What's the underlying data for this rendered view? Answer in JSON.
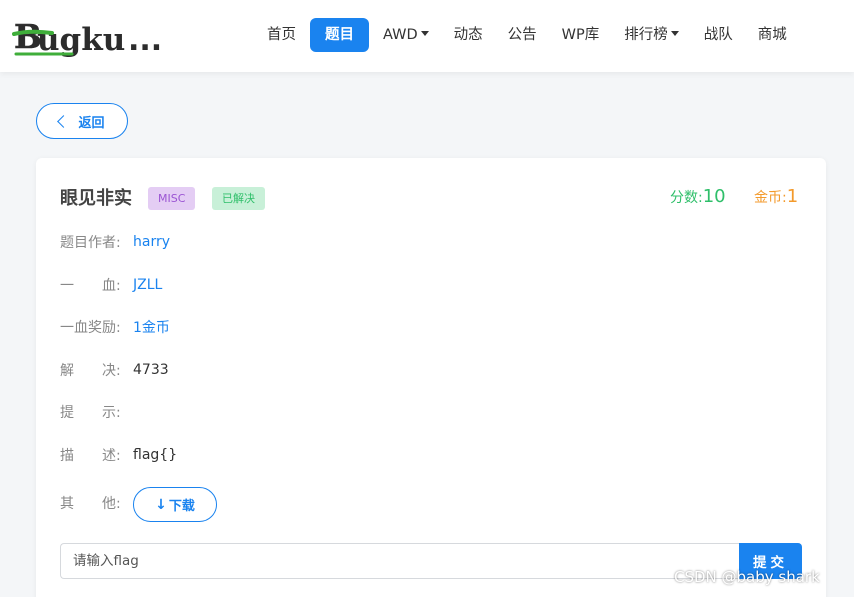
{
  "brand": {
    "logo_text": "Bugku..."
  },
  "nav": {
    "items": [
      {
        "label": "首页",
        "active": false,
        "dropdown": false
      },
      {
        "label": "题目",
        "active": true,
        "dropdown": false
      },
      {
        "label": "AWD",
        "active": false,
        "dropdown": true
      },
      {
        "label": "动态",
        "active": false,
        "dropdown": false
      },
      {
        "label": "公告",
        "active": false,
        "dropdown": false
      },
      {
        "label": "WP库",
        "active": false,
        "dropdown": false
      },
      {
        "label": "排行榜",
        "active": false,
        "dropdown": true
      },
      {
        "label": "战队",
        "active": false,
        "dropdown": false
      },
      {
        "label": "商城",
        "active": false,
        "dropdown": false
      }
    ]
  },
  "back_label": "返回",
  "challenge": {
    "title": "眼见非实",
    "category_tag": "MISC",
    "status_tag": "已解决",
    "score_label": "分数:",
    "score": "10",
    "coin_label": "金币:",
    "coin": "1",
    "fields": [
      {
        "label": "题目作者:",
        "value": "harry",
        "link": true
      },
      {
        "label": "一　　血:",
        "value": "JZLL",
        "link": true
      },
      {
        "label": "一血奖励:",
        "value": "1金币",
        "link": true
      },
      {
        "label": "解　　决:",
        "value": "4733",
        "link": false
      },
      {
        "label": "提　　示:",
        "value": "",
        "link": false
      },
      {
        "label": "描　　述:",
        "value": "flag{}",
        "link": false
      }
    ],
    "other_label": "其　　他:",
    "download_label": "下载",
    "flag_placeholder": "请输入flag",
    "submit_label": "提交"
  },
  "watermark": "CSDN @baby shark",
  "colors": {
    "primary": "#1a83ef",
    "score": "#2fbf6a",
    "coin": "#f39a2c",
    "misc_tag": "#9b54d3"
  }
}
